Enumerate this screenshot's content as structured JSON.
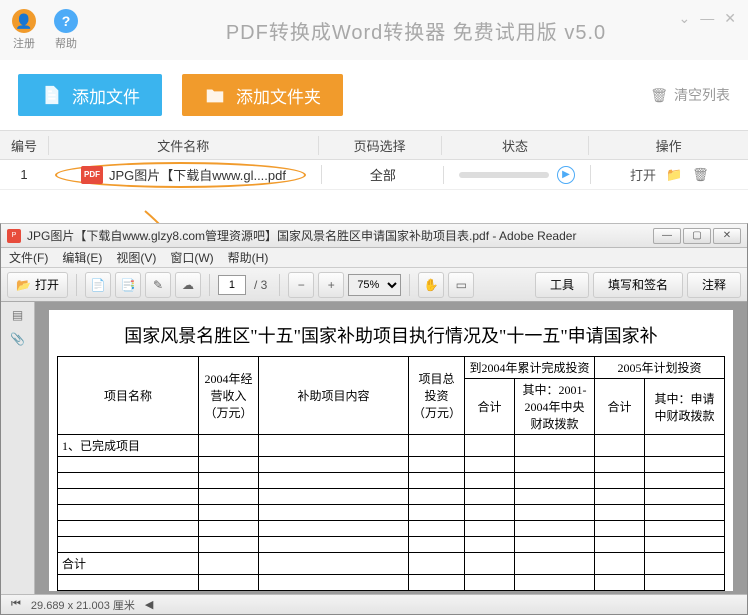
{
  "topbar": {
    "register": "注册",
    "help": "帮助",
    "title": "PDF转换成Word转换器 免费试用版 v5.0"
  },
  "actions": {
    "add_file": "添加文件",
    "add_folder": "添加文件夹",
    "clear_list": "清空列表"
  },
  "columns": {
    "no": "编号",
    "name": "文件名称",
    "page": "页码选择",
    "status": "状态",
    "op": "操作"
  },
  "row": {
    "no": "1",
    "pdf_chip": "PDF",
    "filename": "JPG图片【下载自www.gl....pdf",
    "page_sel": "全部",
    "open": "打开"
  },
  "reader": {
    "title_prefix": "JPG图片【下载自www.glzy8.com管理资源吧】国家风景名胜区申请国家补助项目表.pdf - Adobe Reader",
    "menu": {
      "file": "文件(F)",
      "edit": "编辑(E)",
      "view": "视图(V)",
      "window": "窗口(W)",
      "help": "帮助(H)"
    },
    "open_btn": "打开",
    "page_cur": "1",
    "page_total": "/ 3",
    "zoom": "75%",
    "tools": "工具",
    "fill_sign": "填写和签名",
    "comment": "注释",
    "status": "29.689 x 21.003 厘米"
  },
  "doc": {
    "title": "国家风景名胜区\"十五\"国家补助项目执行情况及\"十一五\"申请国家补",
    "hdr": {
      "proj_name": "项目名称",
      "income_2004": "2004年经营收入（万元）",
      "subsidy_content": "补助项目内容",
      "total_invest": "项目总投资（万元）",
      "cum_2004": "到2004年累计完成投资",
      "plan_2005": "2005年计划投资",
      "subtotal": "合计",
      "central_0104": "其中：2001-2004年中央财政拨款",
      "req_central": "其中：申请中财政拨款"
    },
    "rows": {
      "done_title": "1、已完成项目",
      "total": "合计"
    }
  }
}
